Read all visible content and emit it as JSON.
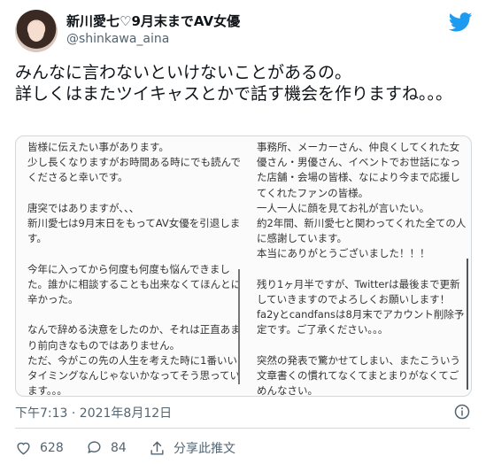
{
  "user": {
    "name": "新川愛七♡9月末までAV女優",
    "handle": "@shinkawa_aina"
  },
  "tweet": {
    "text": "みんなに言わないといけないことがあるの。\n詳しくはまたツイキャスとかで話す機会を作りますね。。。"
  },
  "media": {
    "left_text": "皆様に伝えたい事があります。\n少し長くなりますがお時間ある時にでも読んでくださると幸いです。\n\n唐突ではありますが、、、\n新川愛七は9月末日をもってAV女優を引退します。\n\n今年に入ってから何度も何度も悩んできました。誰かに相談することも出来なくてほんとに辛かった。\n\nなんで辞める決意をしたのか、それは正直あまり前向きなものではありません。\nただ、今がこの先の人生を考えた時に1番いいタイミングなんじゃないかなってそう思っています。。。",
    "right_text": "事務所、メーカーさん、仲良くしてくれた女優さん・男優さん、イベントでお世話になった店舗・会場の皆様、なにより今まで応援してくれたファンの皆様。\n一人一人に顔を見てお礼が言いたい。\n約2年間、新川愛七と関わってくれた全ての人に感謝しています。\n本当にありがとうございました！！！\n\n残り1ヶ月半ですが、Twitterは最後まで更新していきますのでよろしくお願いします！\nfa2yとcandfansは8月末でアカウント削除予定です。ご了承ください。。。\n\n突然の発表で驚かせてしまい、またこういう文章書くの慣れてなくてまとまりがなくてごめんなさい。"
  },
  "timestamp": "下午7:13 · 2021年8月12日",
  "actions": {
    "likes": "628",
    "replies": "84",
    "share_label": "分享此推文"
  },
  "colors": {
    "twitter_blue": "#1d9bf0",
    "secondary_text": "#536471",
    "border": "#cfd9de"
  },
  "icons": [
    "twitter-bird-icon",
    "info-icon",
    "heart-icon",
    "reply-icon",
    "share-icon"
  ]
}
